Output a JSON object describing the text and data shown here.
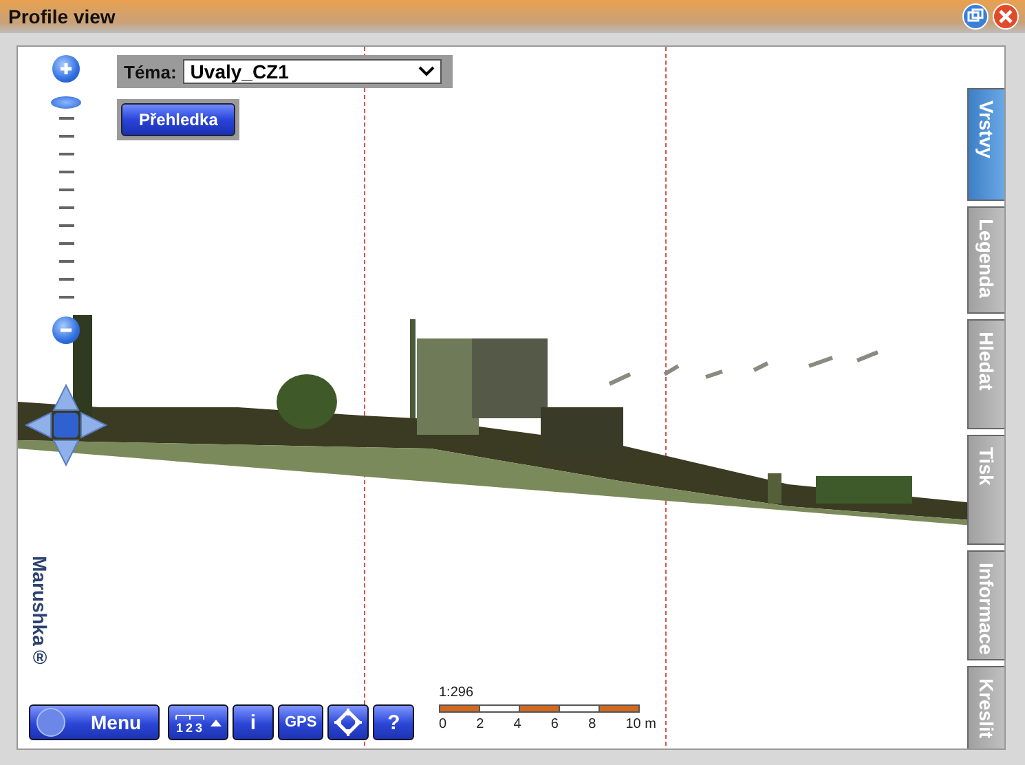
{
  "window": {
    "title": "Profile view"
  },
  "theme": {
    "label": "Téma:",
    "value": "Uvaly_CZ1"
  },
  "overview_button": {
    "label": "Přehledka"
  },
  "zoom": {
    "level": 0.95
  },
  "side_tabs": [
    {
      "label": "Vrstvy",
      "selected": true
    },
    {
      "label": "Legenda",
      "selected": false
    },
    {
      "label": "Hledat",
      "selected": false
    },
    {
      "label": "Tisk",
      "selected": false
    },
    {
      "label": "Informace",
      "selected": false
    },
    {
      "label": "Kreslit",
      "selected": false
    }
  ],
  "logo": {
    "text": "Marushka®"
  },
  "toolbar": [
    {
      "kind": "menu",
      "label": "Menu"
    },
    {
      "kind": "list",
      "digits": [
        "1",
        "2",
        "3"
      ]
    },
    {
      "kind": "text",
      "label": "i"
    },
    {
      "kind": "small-text",
      "label": "GPS"
    },
    {
      "kind": "target"
    },
    {
      "kind": "text",
      "label": "?"
    }
  ],
  "scale": {
    "ratio": "1:296",
    "labels": [
      "0",
      "2",
      "4",
      "6",
      "8",
      "10 m"
    ]
  }
}
